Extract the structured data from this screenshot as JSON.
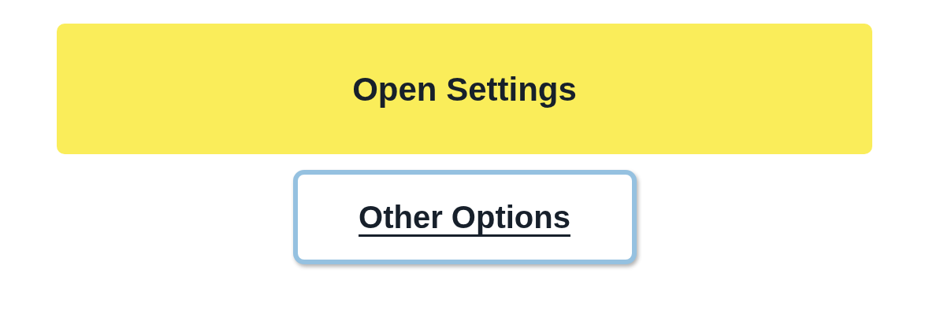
{
  "buttons": [
    {
      "label": "Open Settings",
      "kind": "primary",
      "focused": false
    },
    {
      "label": "Other Options",
      "kind": "link",
      "focused": true
    }
  ]
}
